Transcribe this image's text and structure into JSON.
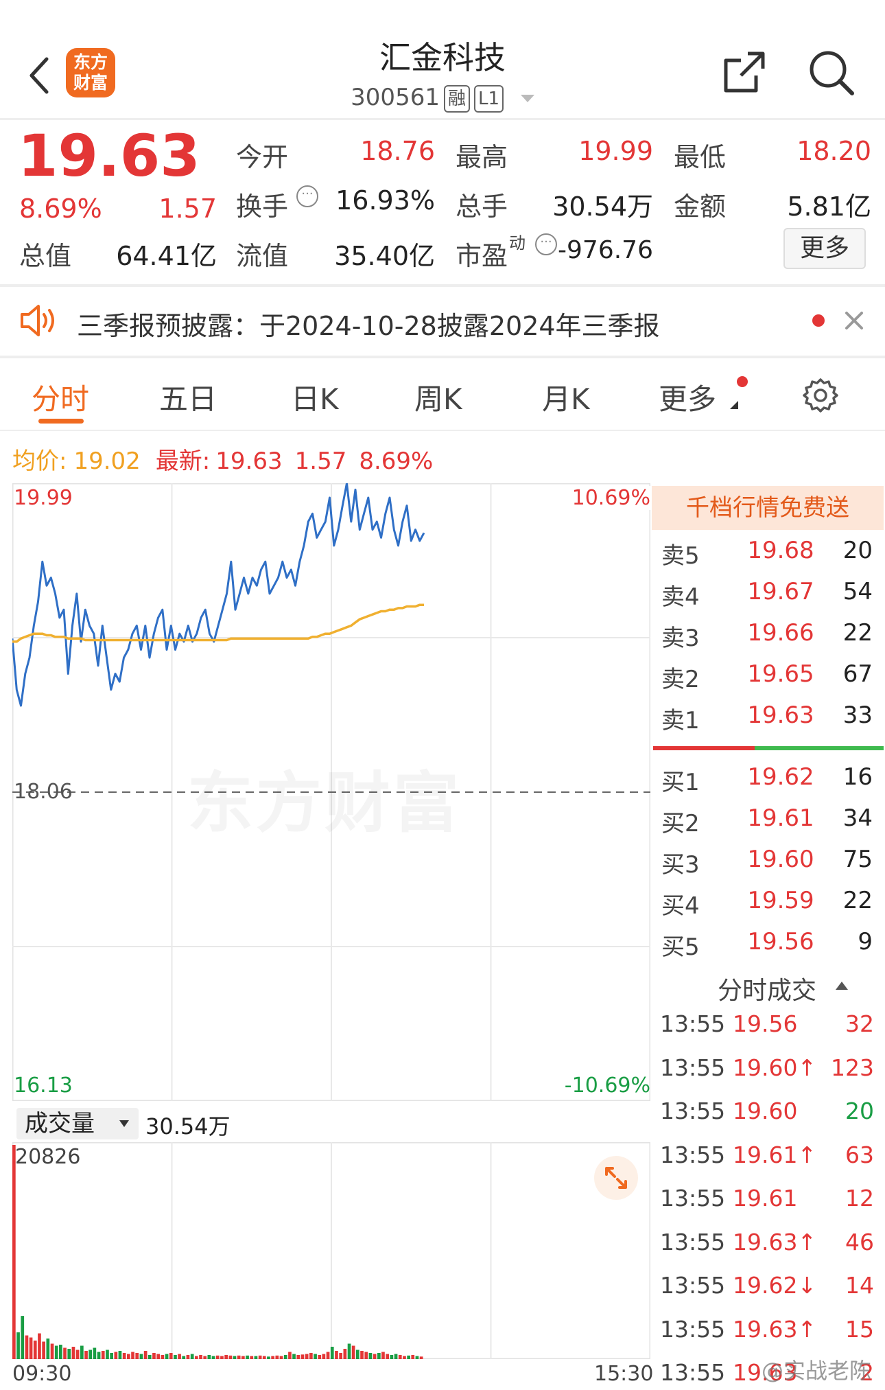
{
  "nav": {
    "title": "汇金科技",
    "code": "300561",
    "tag_rong": "融",
    "tag_l1": "L1",
    "logo_line1": "东方",
    "logo_line2": "财富"
  },
  "quote": {
    "price": "19.63",
    "pct": "8.69%",
    "chg": "1.57",
    "open_label": "今开",
    "open": "18.76",
    "high_label": "最高",
    "high": "19.99",
    "low_label": "最低",
    "low": "18.20",
    "turnover_label": "换手",
    "turnover": "16.93%",
    "volume_label": "总手",
    "volume": "30.54万",
    "amount_label": "金额",
    "amount": "5.81亿",
    "mcap_label": "总值",
    "mcap": "64.41亿",
    "float_label": "流值",
    "float": "35.40亿",
    "pe_label": "市盈",
    "pe_sup": "动",
    "pe": "-976.76",
    "more_button": "更多"
  },
  "notice": {
    "text": "三季报预披露：于2024-10-28披露2024年三季报"
  },
  "tabs": [
    "分时",
    "五日",
    "日K",
    "周K",
    "月K",
    "更多"
  ],
  "info_line": {
    "avg_label": "均价:",
    "avg": "19.02",
    "latest_label": "最新:",
    "latest": "19.63",
    "chg": "1.57",
    "pct": "8.69%"
  },
  "chart_labels": {
    "high": "19.99",
    "high_pct": "10.69%",
    "prev_close": "18.06",
    "low": "16.13",
    "low_pct": "-10.69%",
    "watermark": "东方财富",
    "vol_selector": "成交量",
    "vol_total": "30.54万",
    "vol_max": "20826",
    "time_start": "09:30",
    "time_end": "15:30"
  },
  "colors": {
    "up": "#e33636",
    "down": "#199d44",
    "price_line": "#2f6fc6",
    "avg_line": "#f0b030",
    "accent": "#f06a20"
  },
  "orderbook": {
    "banner": "千档行情免费送",
    "asks": [
      {
        "label": "卖5",
        "price": "19.68",
        "vol": "20"
      },
      {
        "label": "卖4",
        "price": "19.67",
        "vol": "54"
      },
      {
        "label": "卖3",
        "price": "19.66",
        "vol": "22"
      },
      {
        "label": "卖2",
        "price": "19.65",
        "vol": "67"
      },
      {
        "label": "卖1",
        "price": "19.63",
        "vol": "33"
      }
    ],
    "bids": [
      {
        "label": "买1",
        "price": "19.62",
        "vol": "16"
      },
      {
        "label": "买2",
        "price": "19.61",
        "vol": "34"
      },
      {
        "label": "买3",
        "price": "19.60",
        "vol": "75"
      },
      {
        "label": "买4",
        "price": "19.59",
        "vol": "22"
      },
      {
        "label": "买5",
        "price": "19.56",
        "vol": "9"
      }
    ]
  },
  "trades": {
    "title": "分时成交",
    "rows": [
      {
        "time": "13:55",
        "price": "19.56",
        "vol": "32",
        "dir": "up"
      },
      {
        "time": "13:55",
        "price": "19.60↑",
        "vol": "123",
        "dir": "up"
      },
      {
        "time": "13:55",
        "price": "19.60",
        "vol": "20",
        "dir": "down"
      },
      {
        "time": "13:55",
        "price": "19.61↑",
        "vol": "63",
        "dir": "up"
      },
      {
        "time": "13:55",
        "price": "19.61",
        "vol": "12",
        "dir": "up"
      },
      {
        "time": "13:55",
        "price": "19.63↑",
        "vol": "46",
        "dir": "up"
      },
      {
        "time": "13:55",
        "price": "19.62↓",
        "vol": "14",
        "dir": "up"
      },
      {
        "time": "13:55",
        "price": "19.63↑",
        "vol": "15",
        "dir": "up"
      },
      {
        "time": "13:55",
        "price": "19.63",
        "vol": "2",
        "dir": "up"
      }
    ]
  },
  "footer_watermark": "@实战老陈",
  "chart_data": {
    "type": "line",
    "title": "",
    "x_range": [
      "09:30",
      "15:30"
    ],
    "ylim": [
      16.13,
      19.99
    ],
    "prev_close": 18.06,
    "series": [
      {
        "name": "",
        "values": [
          19.02,
          18.7,
          18.6,
          18.8,
          18.9,
          19.1,
          19.25,
          19.5,
          19.35,
          19.4,
          19.3,
          19.15,
          19.2,
          18.8,
          19.1,
          19.3,
          19.0,
          19.2,
          19.1,
          19.05,
          18.85,
          19.1,
          18.9,
          18.7,
          18.8,
          18.75,
          18.9,
          18.95,
          19.05,
          19.1,
          18.95,
          19.1,
          18.9,
          19.05,
          19.15,
          19.2,
          18.95,
          19.1,
          18.95,
          19.05,
          19.0,
          19.1,
          19.0,
          19.05,
          19.15,
          19.2,
          19.05,
          19.0,
          19.1,
          19.2,
          19.3,
          19.5,
          19.2,
          19.3,
          19.4,
          19.3,
          19.4,
          19.35,
          19.45,
          19.5,
          19.3,
          19.35,
          19.4,
          19.5,
          19.4,
          19.45,
          19.35,
          19.5,
          19.6,
          19.75,
          19.8,
          19.65,
          19.7,
          19.75,
          19.9,
          19.6,
          19.7,
          19.85,
          19.99,
          19.75,
          19.95,
          19.7,
          19.8,
          19.9,
          19.7,
          19.75,
          19.65,
          19.8,
          19.9,
          19.7,
          19.6,
          19.75,
          19.85,
          19.63,
          19.7,
          19.63,
          19.68
        ]
      },
      {
        "name": "",
        "values": [
          19.0,
          19.0,
          19.02,
          19.03,
          19.04,
          19.05,
          19.05,
          19.05,
          19.04,
          19.04,
          19.03,
          19.03,
          19.03,
          19.02,
          19.02,
          19.02,
          19.02,
          19.01,
          19.01,
          19.01,
          19.01,
          19.01,
          19.01,
          19.01,
          19.01,
          19.01,
          19.01,
          19.01,
          19.01,
          19.01,
          19.01,
          19.01,
          19.01,
          19.01,
          19.01,
          19.01,
          19.01,
          19.01,
          19.01,
          19.01,
          19.01,
          19.01,
          19.01,
          19.01,
          19.01,
          19.01,
          19.01,
          19.01,
          19.01,
          19.01,
          19.01,
          19.02,
          19.02,
          19.02,
          19.02,
          19.02,
          19.02,
          19.02,
          19.02,
          19.02,
          19.02,
          19.02,
          19.02,
          19.02,
          19.02,
          19.02,
          19.02,
          19.02,
          19.02,
          19.02,
          19.03,
          19.03,
          19.04,
          19.05,
          19.05,
          19.06,
          19.07,
          19.08,
          19.09,
          19.1,
          19.12,
          19.14,
          19.15,
          19.16,
          19.17,
          19.18,
          19.19,
          19.19,
          19.2,
          19.2,
          19.21,
          19.21,
          19.22,
          19.22,
          19.22,
          19.23,
          19.23
        ]
      }
    ],
    "volume": [
      20826,
      2600,
      4200,
      2300,
      2100,
      1800,
      2500,
      1700,
      2000,
      1500,
      1300,
      1400,
      1100,
      1000,
      1200,
      900,
      1300,
      800,
      900,
      1100,
      700,
      800,
      900,
      600,
      700,
      800,
      600,
      500,
      700,
      600,
      500,
      800,
      400,
      600,
      500,
      400,
      500,
      600,
      400,
      500,
      300,
      400,
      500,
      300,
      400,
      300,
      400,
      300,
      350,
      300,
      400,
      350,
      300,
      350,
      300,
      350,
      300,
      300,
      350,
      300,
      250,
      300,
      350,
      300,
      400,
      700,
      500,
      400,
      450,
      500,
      600,
      500,
      400,
      500,
      700,
      1200,
      800,
      600,
      1000,
      1500,
      1300,
      900,
      800,
      700,
      600,
      500,
      600,
      700,
      500,
      400,
      500,
      400,
      300,
      350,
      400,
      300,
      250
    ]
  }
}
